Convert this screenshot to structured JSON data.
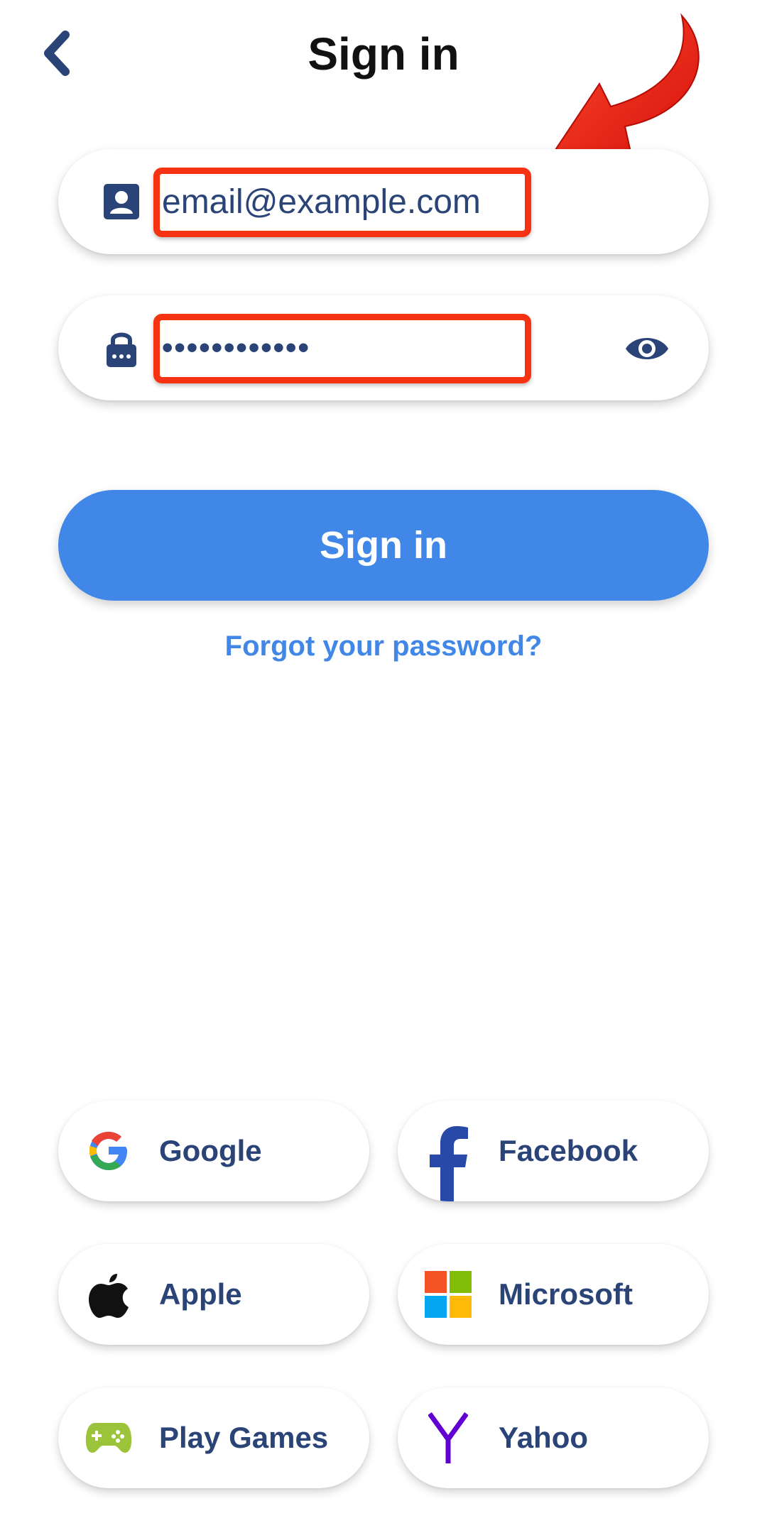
{
  "header": {
    "title": "Sign in"
  },
  "form": {
    "email_value": "email@example.com",
    "password_value": "••••••••••••"
  },
  "actions": {
    "signin_label": "Sign in",
    "forgot_label": "Forgot your password?"
  },
  "providers": [
    {
      "label": "Google",
      "icon": "google-icon"
    },
    {
      "label": "Facebook",
      "icon": "facebook-icon"
    },
    {
      "label": "Apple",
      "icon": "apple-icon"
    },
    {
      "label": "Microsoft",
      "icon": "microsoft-icon"
    },
    {
      "label": "Play Games",
      "icon": "play-games-icon"
    },
    {
      "label": "Yahoo",
      "icon": "yahoo-icon"
    }
  ],
  "colors": {
    "accent": "#4187e8",
    "text_navy": "#2b4478",
    "annotation_red": "#f53212"
  }
}
